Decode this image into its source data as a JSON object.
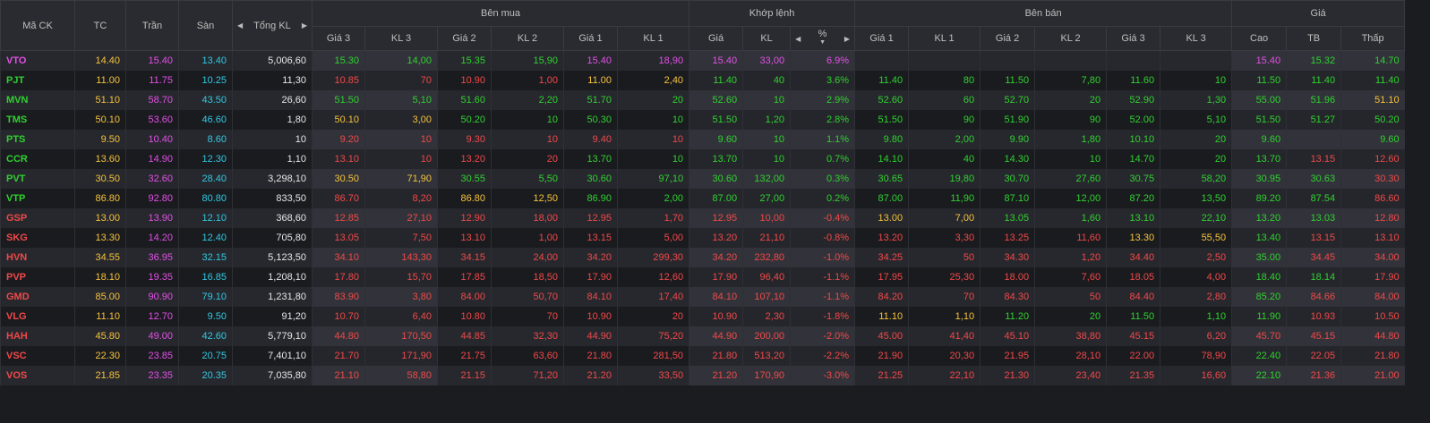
{
  "headers": {
    "symbol": "Mã CK",
    "ref": "TC",
    "ceil": "Trần",
    "floor": "Sàn",
    "total_volume": "Tổng KL",
    "buy_group": "Bên mua",
    "match_group": "Khớp lệnh",
    "sell_group": "Bên bán",
    "price_group": "Giá",
    "buy_cols": [
      "Giá 3",
      "KL 3",
      "Giá 2",
      "KL 2",
      "Giá 1",
      "KL 1"
    ],
    "match_cols": [
      "Giá",
      "KL",
      "%"
    ],
    "sell_cols": [
      "Giá 1",
      "KL 1",
      "Giá 2",
      "KL 2",
      "Giá 3",
      "KL 3"
    ],
    "price_cols": [
      "Cao",
      "TB",
      "Thấp"
    ]
  },
  "icons": {
    "prev": "caret-left-icon",
    "next": "caret-right-icon",
    "sort": "sort-down-icon"
  },
  "colors": {
    "ceil": "#e24fe6",
    "floor": "#30c8e0",
    "ref": "#f5c23a",
    "up": "#2fd12f",
    "down": "#f04848"
  },
  "rows": [
    {
      "sym": [
        "VTO",
        "ceil"
      ],
      "tc": "14.40",
      "tran": "15.40",
      "san": "13.40",
      "tkl": "5,006,60",
      "b3": [
        "15.30",
        "up"
      ],
      "kb3": [
        "14,00",
        "up"
      ],
      "b2": [
        "15.35",
        "up"
      ],
      "kb2": [
        "15,90",
        "up"
      ],
      "b1": [
        "15.40",
        "ceil"
      ],
      "kb1": [
        "18,90",
        "ceil"
      ],
      "mp": [
        "15.40",
        "ceil"
      ],
      "mk": [
        "33,00",
        "ceil"
      ],
      "pct": [
        "6.9%",
        "ceil"
      ],
      "s1": [
        "",
        ""
      ],
      "ks1": [
        "",
        ""
      ],
      "s2": [
        "",
        ""
      ],
      "ks2": [
        "",
        ""
      ],
      "s3": [
        "",
        ""
      ],
      "ks3": [
        "",
        ""
      ],
      "hi": [
        "15.40",
        "ceil"
      ],
      "avg": [
        "15.32",
        "up"
      ],
      "lo": [
        "14.70",
        "up"
      ]
    },
    {
      "sym": [
        "PJT",
        "up"
      ],
      "tc": "11.00",
      "tran": "11.75",
      "san": "10.25",
      "tkl": "11,30",
      "b3": [
        "10.85",
        "down"
      ],
      "kb3": [
        "70",
        "down"
      ],
      "b2": [
        "10.90",
        "down"
      ],
      "kb2": [
        "1,00",
        "down"
      ],
      "b1": [
        "11.00",
        "ref"
      ],
      "kb1": [
        "2,40",
        "ref"
      ],
      "mp": [
        "11.40",
        "up"
      ],
      "mk": [
        "40",
        "up"
      ],
      "pct": [
        "3.6%",
        "up"
      ],
      "s1": [
        "11.40",
        "up"
      ],
      "ks1": [
        "80",
        "up"
      ],
      "s2": [
        "11.50",
        "up"
      ],
      "ks2": [
        "7,80",
        "up"
      ],
      "s3": [
        "11.60",
        "up"
      ],
      "ks3": [
        "10",
        "up"
      ],
      "hi": [
        "11.50",
        "up"
      ],
      "avg": [
        "11.40",
        "up"
      ],
      "lo": [
        "11.40",
        "up"
      ]
    },
    {
      "sym": [
        "MVN",
        "up"
      ],
      "tc": "51.10",
      "tran": "58.70",
      "san": "43.50",
      "tkl": "26,60",
      "b3": [
        "51.50",
        "up"
      ],
      "kb3": [
        "5,10",
        "up"
      ],
      "b2": [
        "51.60",
        "up"
      ],
      "kb2": [
        "2,20",
        "up"
      ],
      "b1": [
        "51.70",
        "up"
      ],
      "kb1": [
        "20",
        "up"
      ],
      "mp": [
        "52.60",
        "up"
      ],
      "mk": [
        "10",
        "up"
      ],
      "pct": [
        "2.9%",
        "up"
      ],
      "s1": [
        "52.60",
        "up"
      ],
      "ks1": [
        "60",
        "up"
      ],
      "s2": [
        "52.70",
        "up"
      ],
      "ks2": [
        "20",
        "up"
      ],
      "s3": [
        "52.90",
        "up"
      ],
      "ks3": [
        "1,30",
        "up"
      ],
      "hi": [
        "55.00",
        "up"
      ],
      "avg": [
        "51.96",
        "up"
      ],
      "lo": [
        "51.10",
        "ref"
      ]
    },
    {
      "sym": [
        "TMS",
        "up"
      ],
      "tc": "50.10",
      "tran": "53.60",
      "san": "46.60",
      "tkl": "1,80",
      "b3": [
        "50.10",
        "ref"
      ],
      "kb3": [
        "3,00",
        "ref"
      ],
      "b2": [
        "50.20",
        "up"
      ],
      "kb2": [
        "10",
        "up"
      ],
      "b1": [
        "50.30",
        "up"
      ],
      "kb1": [
        "10",
        "up"
      ],
      "mp": [
        "51.50",
        "up"
      ],
      "mk": [
        "1,20",
        "up"
      ],
      "pct": [
        "2.8%",
        "up"
      ],
      "s1": [
        "51.50",
        "up"
      ],
      "ks1": [
        "90",
        "up"
      ],
      "s2": [
        "51.90",
        "up"
      ],
      "ks2": [
        "90",
        "up"
      ],
      "s3": [
        "52.00",
        "up"
      ],
      "ks3": [
        "5,10",
        "up"
      ],
      "hi": [
        "51.50",
        "up"
      ],
      "avg": [
        "51.27",
        "up"
      ],
      "lo": [
        "50.20",
        "up"
      ]
    },
    {
      "sym": [
        "PTS",
        "up"
      ],
      "tc": "9.50",
      "tran": "10.40",
      "san": "8.60",
      "tkl": "10",
      "b3": [
        "9.20",
        "down"
      ],
      "kb3": [
        "10",
        "down"
      ],
      "b2": [
        "9.30",
        "down"
      ],
      "kb2": [
        "10",
        "down"
      ],
      "b1": [
        "9.40",
        "down"
      ],
      "kb1": [
        "10",
        "down"
      ],
      "mp": [
        "9.60",
        "up"
      ],
      "mk": [
        "10",
        "up"
      ],
      "pct": [
        "1.1%",
        "up"
      ],
      "s1": [
        "9.80",
        "up"
      ],
      "ks1": [
        "2,00",
        "up"
      ],
      "s2": [
        "9.90",
        "up"
      ],
      "ks2": [
        "1,80",
        "up"
      ],
      "s3": [
        "10.10",
        "up"
      ],
      "ks3": [
        "20",
        "up"
      ],
      "hi": [
        "9.60",
        "up"
      ],
      "avg": [
        "",
        ""
      ],
      "lo": [
        "9.60",
        "up"
      ]
    },
    {
      "sym": [
        "CCR",
        "up"
      ],
      "tc": "13.60",
      "tran": "14.90",
      "san": "12.30",
      "tkl": "1,10",
      "b3": [
        "13.10",
        "down"
      ],
      "kb3": [
        "10",
        "down"
      ],
      "b2": [
        "13.20",
        "down"
      ],
      "kb2": [
        "20",
        "down"
      ],
      "b1": [
        "13.70",
        "up"
      ],
      "kb1": [
        "10",
        "up"
      ],
      "mp": [
        "13.70",
        "up"
      ],
      "mk": [
        "10",
        "up"
      ],
      "pct": [
        "0.7%",
        "up"
      ],
      "s1": [
        "14.10",
        "up"
      ],
      "ks1": [
        "40",
        "up"
      ],
      "s2": [
        "14.30",
        "up"
      ],
      "ks2": [
        "10",
        "up"
      ],
      "s3": [
        "14.70",
        "up"
      ],
      "ks3": [
        "20",
        "up"
      ],
      "hi": [
        "13.70",
        "up"
      ],
      "avg": [
        "13.15",
        "down"
      ],
      "lo": [
        "12.60",
        "down"
      ]
    },
    {
      "sym": [
        "PVT",
        "up"
      ],
      "tc": "30.50",
      "tran": "32.60",
      "san": "28.40",
      "tkl": "3,298,10",
      "b3": [
        "30.50",
        "ref"
      ],
      "kb3": [
        "71,90",
        "ref"
      ],
      "b2": [
        "30.55",
        "up"
      ],
      "kb2": [
        "5,50",
        "up"
      ],
      "b1": [
        "30.60",
        "up"
      ],
      "kb1": [
        "97,10",
        "up"
      ],
      "mp": [
        "30.60",
        "up"
      ],
      "mk": [
        "132,00",
        "up"
      ],
      "pct": [
        "0.3%",
        "up"
      ],
      "s1": [
        "30.65",
        "up"
      ],
      "ks1": [
        "19,80",
        "up"
      ],
      "s2": [
        "30.70",
        "up"
      ],
      "ks2": [
        "27,60",
        "up"
      ],
      "s3": [
        "30.75",
        "up"
      ],
      "ks3": [
        "58,20",
        "up"
      ],
      "hi": [
        "30.95",
        "up"
      ],
      "avg": [
        "30.63",
        "up"
      ],
      "lo": [
        "30.30",
        "down"
      ]
    },
    {
      "sym": [
        "VTP",
        "up"
      ],
      "tc": "86.80",
      "tran": "92.80",
      "san": "80.80",
      "tkl": "833,50",
      "b3": [
        "86.70",
        "down"
      ],
      "kb3": [
        "8,20",
        "down"
      ],
      "b2": [
        "86.80",
        "ref"
      ],
      "kb2": [
        "12,50",
        "ref"
      ],
      "b1": [
        "86.90",
        "up"
      ],
      "kb1": [
        "2,00",
        "up"
      ],
      "mp": [
        "87.00",
        "up"
      ],
      "mk": [
        "27,00",
        "up"
      ],
      "pct": [
        "0.2%",
        "up"
      ],
      "s1": [
        "87.00",
        "up"
      ],
      "ks1": [
        "11,90",
        "up"
      ],
      "s2": [
        "87.10",
        "up"
      ],
      "ks2": [
        "12,00",
        "up"
      ],
      "s3": [
        "87.20",
        "up"
      ],
      "ks3": [
        "13,50",
        "up"
      ],
      "hi": [
        "89.20",
        "up"
      ],
      "avg": [
        "87.54",
        "up"
      ],
      "lo": [
        "86.60",
        "down"
      ]
    },
    {
      "sym": [
        "GSP",
        "down"
      ],
      "tc": "13.00",
      "tran": "13.90",
      "san": "12.10",
      "tkl": "368,60",
      "b3": [
        "12.85",
        "down"
      ],
      "kb3": [
        "27,10",
        "down"
      ],
      "b2": [
        "12.90",
        "down"
      ],
      "kb2": [
        "18,00",
        "down"
      ],
      "b1": [
        "12.95",
        "down"
      ],
      "kb1": [
        "1,70",
        "down"
      ],
      "mp": [
        "12.95",
        "down"
      ],
      "mk": [
        "10,00",
        "down"
      ],
      "pct": [
        "-0.4%",
        "down"
      ],
      "s1": [
        "13.00",
        "ref"
      ],
      "ks1": [
        "7,00",
        "ref"
      ],
      "s2": [
        "13.05",
        "up"
      ],
      "ks2": [
        "1,60",
        "up"
      ],
      "s3": [
        "13.10",
        "up"
      ],
      "ks3": [
        "22,10",
        "up"
      ],
      "hi": [
        "13.20",
        "up"
      ],
      "avg": [
        "13.03",
        "up"
      ],
      "lo": [
        "12.80",
        "down"
      ]
    },
    {
      "sym": [
        "SKG",
        "down"
      ],
      "tc": "13.30",
      "tran": "14.20",
      "san": "12.40",
      "tkl": "705,80",
      "b3": [
        "13.05",
        "down"
      ],
      "kb3": [
        "7,50",
        "down"
      ],
      "b2": [
        "13.10",
        "down"
      ],
      "kb2": [
        "1,00",
        "down"
      ],
      "b1": [
        "13.15",
        "down"
      ],
      "kb1": [
        "5,00",
        "down"
      ],
      "mp": [
        "13.20",
        "down"
      ],
      "mk": [
        "21,10",
        "down"
      ],
      "pct": [
        "-0.8%",
        "down"
      ],
      "s1": [
        "13.20",
        "down"
      ],
      "ks1": [
        "3,30",
        "down"
      ],
      "s2": [
        "13.25",
        "down"
      ],
      "ks2": [
        "11,60",
        "down"
      ],
      "s3": [
        "13.30",
        "ref"
      ],
      "ks3": [
        "55,50",
        "ref"
      ],
      "hi": [
        "13.40",
        "up"
      ],
      "avg": [
        "13.15",
        "down"
      ],
      "lo": [
        "13.10",
        "down"
      ]
    },
    {
      "sym": [
        "HVN",
        "down"
      ],
      "tc": "34.55",
      "tran": "36.95",
      "san": "32.15",
      "tkl": "5,123,50",
      "b3": [
        "34.10",
        "down"
      ],
      "kb3": [
        "143,30",
        "down"
      ],
      "b2": [
        "34.15",
        "down"
      ],
      "kb2": [
        "24,00",
        "down"
      ],
      "b1": [
        "34.20",
        "down"
      ],
      "kb1": [
        "299,30",
        "down"
      ],
      "mp": [
        "34.20",
        "down"
      ],
      "mk": [
        "232,80",
        "down"
      ],
      "pct": [
        "-1.0%",
        "down"
      ],
      "s1": [
        "34.25",
        "down"
      ],
      "ks1": [
        "50",
        "down"
      ],
      "s2": [
        "34.30",
        "down"
      ],
      "ks2": [
        "1,20",
        "down"
      ],
      "s3": [
        "34.40",
        "down"
      ],
      "ks3": [
        "2,50",
        "down"
      ],
      "hi": [
        "35.00",
        "up"
      ],
      "avg": [
        "34.45",
        "down"
      ],
      "lo": [
        "34.00",
        "down"
      ]
    },
    {
      "sym": [
        "PVP",
        "down"
      ],
      "tc": "18.10",
      "tran": "19.35",
      "san": "16.85",
      "tkl": "1,208,10",
      "b3": [
        "17.80",
        "down"
      ],
      "kb3": [
        "15,70",
        "down"
      ],
      "b2": [
        "17.85",
        "down"
      ],
      "kb2": [
        "18,50",
        "down"
      ],
      "b1": [
        "17.90",
        "down"
      ],
      "kb1": [
        "12,60",
        "down"
      ],
      "mp": [
        "17.90",
        "down"
      ],
      "mk": [
        "96,40",
        "down"
      ],
      "pct": [
        "-1.1%",
        "down"
      ],
      "s1": [
        "17.95",
        "down"
      ],
      "ks1": [
        "25,30",
        "down"
      ],
      "s2": [
        "18.00",
        "down"
      ],
      "ks2": [
        "7,60",
        "down"
      ],
      "s3": [
        "18.05",
        "down"
      ],
      "ks3": [
        "4,00",
        "down"
      ],
      "hi": [
        "18.40",
        "up"
      ],
      "avg": [
        "18.14",
        "up"
      ],
      "lo": [
        "17.90",
        "down"
      ]
    },
    {
      "sym": [
        "GMD",
        "down"
      ],
      "tc": "85.00",
      "tran": "90.90",
      "san": "79.10",
      "tkl": "1,231,80",
      "b3": [
        "83.90",
        "down"
      ],
      "kb3": [
        "3,80",
        "down"
      ],
      "b2": [
        "84.00",
        "down"
      ],
      "kb2": [
        "50,70",
        "down"
      ],
      "b1": [
        "84.10",
        "down"
      ],
      "kb1": [
        "17,40",
        "down"
      ],
      "mp": [
        "84.10",
        "down"
      ],
      "mk": [
        "107,10",
        "down"
      ],
      "pct": [
        "-1.1%",
        "down"
      ],
      "s1": [
        "84.20",
        "down"
      ],
      "ks1": [
        "70",
        "down"
      ],
      "s2": [
        "84.30",
        "down"
      ],
      "ks2": [
        "50",
        "down"
      ],
      "s3": [
        "84.40",
        "down"
      ],
      "ks3": [
        "2,80",
        "down"
      ],
      "hi": [
        "85.20",
        "up"
      ],
      "avg": [
        "84.66",
        "down"
      ],
      "lo": [
        "84.00",
        "down"
      ]
    },
    {
      "sym": [
        "VLG",
        "down"
      ],
      "tc": "11.10",
      "tran": "12.70",
      "san": "9.50",
      "tkl": "91,20",
      "b3": [
        "10.70",
        "down"
      ],
      "kb3": [
        "6,40",
        "down"
      ],
      "b2": [
        "10.80",
        "down"
      ],
      "kb2": [
        "70",
        "down"
      ],
      "b1": [
        "10.90",
        "down"
      ],
      "kb1": [
        "20",
        "down"
      ],
      "mp": [
        "10.90",
        "down"
      ],
      "mk": [
        "2,30",
        "down"
      ],
      "pct": [
        "-1.8%",
        "down"
      ],
      "s1": [
        "11.10",
        "ref"
      ],
      "ks1": [
        "1,10",
        "ref"
      ],
      "s2": [
        "11.20",
        "up"
      ],
      "ks2": [
        "20",
        "up"
      ],
      "s3": [
        "11.50",
        "up"
      ],
      "ks3": [
        "1,10",
        "up"
      ],
      "hi": [
        "11.90",
        "up"
      ],
      "avg": [
        "10.93",
        "down"
      ],
      "lo": [
        "10.50",
        "down"
      ]
    },
    {
      "sym": [
        "HAH",
        "down"
      ],
      "tc": "45.80",
      "tran": "49.00",
      "san": "42.60",
      "tkl": "5,779,10",
      "b3": [
        "44.80",
        "down"
      ],
      "kb3": [
        "170,50",
        "down"
      ],
      "b2": [
        "44.85",
        "down"
      ],
      "kb2": [
        "32,30",
        "down"
      ],
      "b1": [
        "44.90",
        "down"
      ],
      "kb1": [
        "75,20",
        "down"
      ],
      "mp": [
        "44.90",
        "down"
      ],
      "mk": [
        "200,00",
        "down"
      ],
      "pct": [
        "-2.0%",
        "down"
      ],
      "s1": [
        "45.00",
        "down"
      ],
      "ks1": [
        "41,40",
        "down"
      ],
      "s2": [
        "45.10",
        "down"
      ],
      "ks2": [
        "38,80",
        "down"
      ],
      "s3": [
        "45.15",
        "down"
      ],
      "ks3": [
        "6,20",
        "down"
      ],
      "hi": [
        "45.70",
        "down"
      ],
      "avg": [
        "45.15",
        "down"
      ],
      "lo": [
        "44.80",
        "down"
      ]
    },
    {
      "sym": [
        "VSC",
        "down"
      ],
      "tc": "22.30",
      "tran": "23.85",
      "san": "20.75",
      "tkl": "7,401,10",
      "b3": [
        "21.70",
        "down"
      ],
      "kb3": [
        "171,90",
        "down"
      ],
      "b2": [
        "21.75",
        "down"
      ],
      "kb2": [
        "63,60",
        "down"
      ],
      "b1": [
        "21.80",
        "down"
      ],
      "kb1": [
        "281,50",
        "down"
      ],
      "mp": [
        "21.80",
        "down"
      ],
      "mk": [
        "513,20",
        "down"
      ],
      "pct": [
        "-2.2%",
        "down"
      ],
      "s1": [
        "21.90",
        "down"
      ],
      "ks1": [
        "20,30",
        "down"
      ],
      "s2": [
        "21.95",
        "down"
      ],
      "ks2": [
        "28,10",
        "down"
      ],
      "s3": [
        "22.00",
        "down"
      ],
      "ks3": [
        "78,90",
        "down"
      ],
      "hi": [
        "22.40",
        "up"
      ],
      "avg": [
        "22.05",
        "down"
      ],
      "lo": [
        "21.80",
        "down"
      ]
    },
    {
      "sym": [
        "VOS",
        "down"
      ],
      "tc": "21.85",
      "tran": "23.35",
      "san": "20.35",
      "tkl": "7,035,80",
      "b3": [
        "21.10",
        "down"
      ],
      "kb3": [
        "58,80",
        "down"
      ],
      "b2": [
        "21.15",
        "down"
      ],
      "kb2": [
        "71,20",
        "down"
      ],
      "b1": [
        "21.20",
        "down"
      ],
      "kb1": [
        "33,50",
        "down"
      ],
      "mp": [
        "21.20",
        "down"
      ],
      "mk": [
        "170,90",
        "down"
      ],
      "pct": [
        "-3.0%",
        "down"
      ],
      "s1": [
        "21.25",
        "down"
      ],
      "ks1": [
        "22,10",
        "down"
      ],
      "s2": [
        "21.30",
        "down"
      ],
      "ks2": [
        "23,40",
        "down"
      ],
      "s3": [
        "21.35",
        "down"
      ],
      "ks3": [
        "16,60",
        "down"
      ],
      "hi": [
        "22.10",
        "up"
      ],
      "avg": [
        "21.36",
        "down"
      ],
      "lo": [
        "21.00",
        "down"
      ]
    }
  ]
}
